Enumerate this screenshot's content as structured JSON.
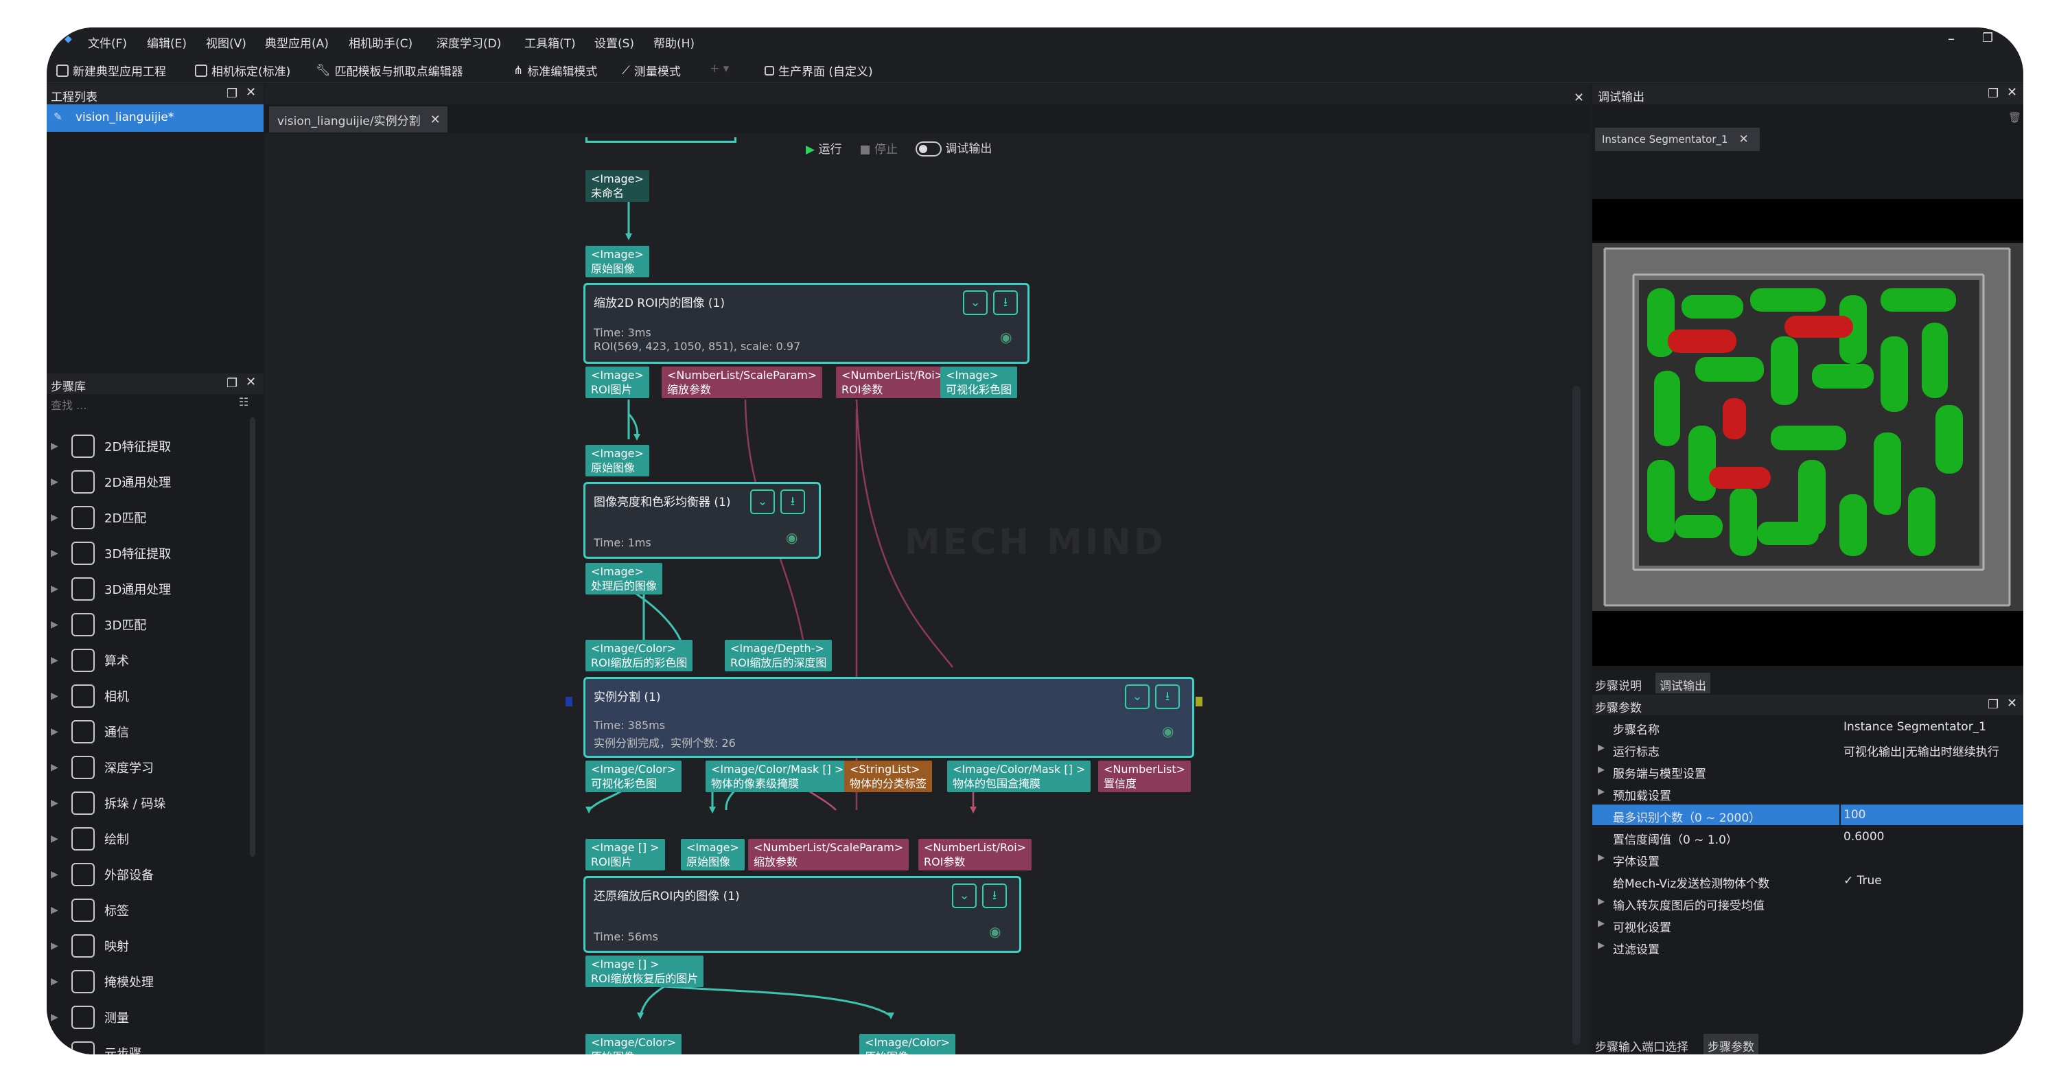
{
  "menu": [
    "文件(F)",
    "编辑(E)",
    "视图(V)",
    "典型应用(A)",
    "相机助手(C)",
    "深度学习(D)",
    "工具箱(T)",
    "设置(S)",
    "帮助(H)"
  ],
  "toolbar": {
    "new_project": "新建典型应用工程",
    "calibration": "相机标定(标准)",
    "match_editor": "匹配模板与抓取点编辑器",
    "standard_mode": "标准编辑模式",
    "measure_mode": "测量模式",
    "production": "生产界面 (自定义)"
  },
  "project_panel": {
    "title": "工程列表",
    "project": "vision_lianguijie*"
  },
  "step_library": {
    "title": "步骤库",
    "search_placeholder": "查找 ...",
    "items": [
      "2D特征提取",
      "2D通用处理",
      "2D匹配",
      "3D特征提取",
      "3D通用处理",
      "3D匹配",
      "算术",
      "相机",
      "通信",
      "深度学习",
      "拆垛 / 码垛",
      "绘制",
      "外部设备",
      "标签",
      "映射",
      "掩模处理",
      "测量",
      "元步骤"
    ]
  },
  "editor": {
    "tab": "vision_lianguijie/实例分割",
    "run": "运行",
    "stop": "停止",
    "debug_output": "调试输出"
  },
  "nodes": {
    "top_port": "<Image>\n未命名",
    "scale_in": "<Image>\n原始图像",
    "scale": {
      "title": "缩放2D ROI内的图像 (1)",
      "time": "Time: 3ms",
      "info": "ROI(569, 423, 1050, 851), scale: 0.97"
    },
    "scale_out": [
      "<Image>\nROI图片",
      "<NumberList/ScaleParam>\n缩放参数",
      "<NumberList/Roi>\nROI参数",
      "<Image>\n可视化彩色图"
    ],
    "balance_in": "<Image>\n原始图像",
    "balance": {
      "title": "图像亮度和色彩均衡器 (1)",
      "time": "Time: 1ms"
    },
    "balance_out": "<Image>\n处理后的图像",
    "seg_in": [
      "<Image/Color>\nROI缩放后的彩色图",
      "<Image/Depth->\nROI缩放后的深度图"
    ],
    "seg": {
      "title": "实例分割 (1)",
      "time": "Time: 385ms",
      "info": "实例分割完成，实例个数: 26"
    },
    "seg_out": [
      "<Image/Color>\n可视化彩色图",
      "<Image/Color/Mask [] >\n物体的像素级掩膜",
      "<StringList>\n物体的分类标签",
      "<Image/Color/Mask [] >\n物体的包围盒掩膜",
      "<NumberList>\n置信度"
    ],
    "restore_in": [
      "<Image [] >\nROI图片",
      "<Image>\n原始图像",
      "<NumberList/ScaleParam>\n缩放参数",
      "<NumberList/Roi>\nROI参数"
    ],
    "restore": {
      "title": "还原缩放后ROI内的图像 (1)",
      "time": "Time: 56ms"
    },
    "restore_out": "<Image [] >\nROI缩放恢复后的图片",
    "bottom_ports": [
      "<Image/Color>\n原始图像",
      "<Image/Color>\n原始图像"
    ],
    "watermark": "MECH MIND"
  },
  "right_panel": {
    "title": "调试输出",
    "tab": "Instance Segmentator_1",
    "bottom_tabs": [
      "步骤说明",
      "调试输出"
    ],
    "params_title": "步骤参数",
    "params": [
      {
        "label": "步骤名称",
        "value": "Instance Segmentator_1",
        "group": false
      },
      {
        "label": "运行标志",
        "value": "可视化输出|无输出时继续执行",
        "group": true
      },
      {
        "label": "服务端与模型设置",
        "value": "",
        "group": true
      },
      {
        "label": "预加载设置",
        "value": "",
        "group": true
      },
      {
        "label": "最多识别个数（0 ~ 2000）",
        "value": "100",
        "group": false,
        "selected": true
      },
      {
        "label": "置信度阈值（0 ~ 1.0）",
        "value": "0.6000",
        "group": false
      },
      {
        "label": "字体设置",
        "value": "",
        "group": true
      },
      {
        "label": "给Mech-Viz发送检测物体个数",
        "value": "✓  True",
        "group": false
      },
      {
        "label": "输入转灰度图后的可接受均值",
        "value": "",
        "group": true
      },
      {
        "label": "可视化设置",
        "value": "",
        "group": true
      },
      {
        "label": "过滤设置",
        "value": "",
        "group": true
      }
    ],
    "footer_tabs": [
      "步骤输入端口选择",
      "步骤参数"
    ]
  }
}
